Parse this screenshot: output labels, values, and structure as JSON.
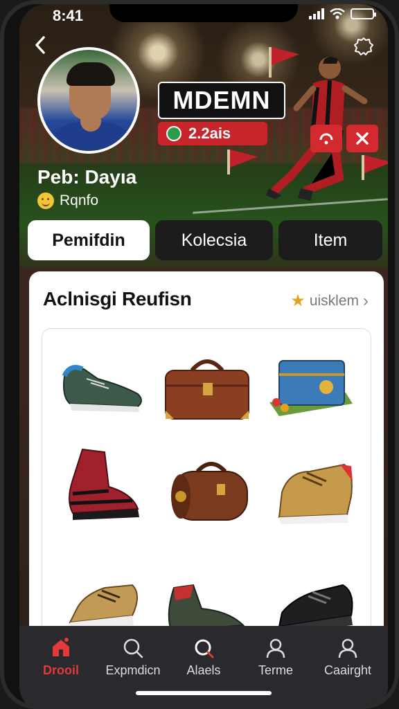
{
  "status_bar": {
    "time": "8:41"
  },
  "header": {
    "title": "MDEMN",
    "coins": "2.2ais",
    "player_name": "Peb: Dayıa",
    "player_sub": "Rqnfo"
  },
  "tabs": [
    {
      "label": "Pemifdin",
      "active": true
    },
    {
      "label": "Kolecsia",
      "active": false
    },
    {
      "label": "Item",
      "active": false
    }
  ],
  "collection": {
    "title": "Aclnisgi Reufisn",
    "link_label": "uisklem",
    "items": [
      {
        "name": "green-cleat"
      },
      {
        "name": "leather-chest"
      },
      {
        "name": "blue-suitcase"
      },
      {
        "name": "red-boot"
      },
      {
        "name": "leather-roll-bag"
      },
      {
        "name": "tan-sneaker"
      },
      {
        "name": "tan-boot"
      },
      {
        "name": "green-red-shoe"
      },
      {
        "name": "black-shoe"
      }
    ]
  },
  "bottom_nav": [
    {
      "label": "Drooil",
      "icon": "home-icon",
      "active": true
    },
    {
      "label": "Expmdicn",
      "icon": "search-icon",
      "active": false
    },
    {
      "label": "Alaels",
      "icon": "search-icon",
      "active": false
    },
    {
      "label": "Terme",
      "icon": "person-icon",
      "active": false
    },
    {
      "label": "Caairght",
      "icon": "person-icon",
      "active": false
    }
  ],
  "colors": {
    "accent": "#d22a2e",
    "nav_bg": "#2a2a2e",
    "card_bg": "#ffffff"
  }
}
